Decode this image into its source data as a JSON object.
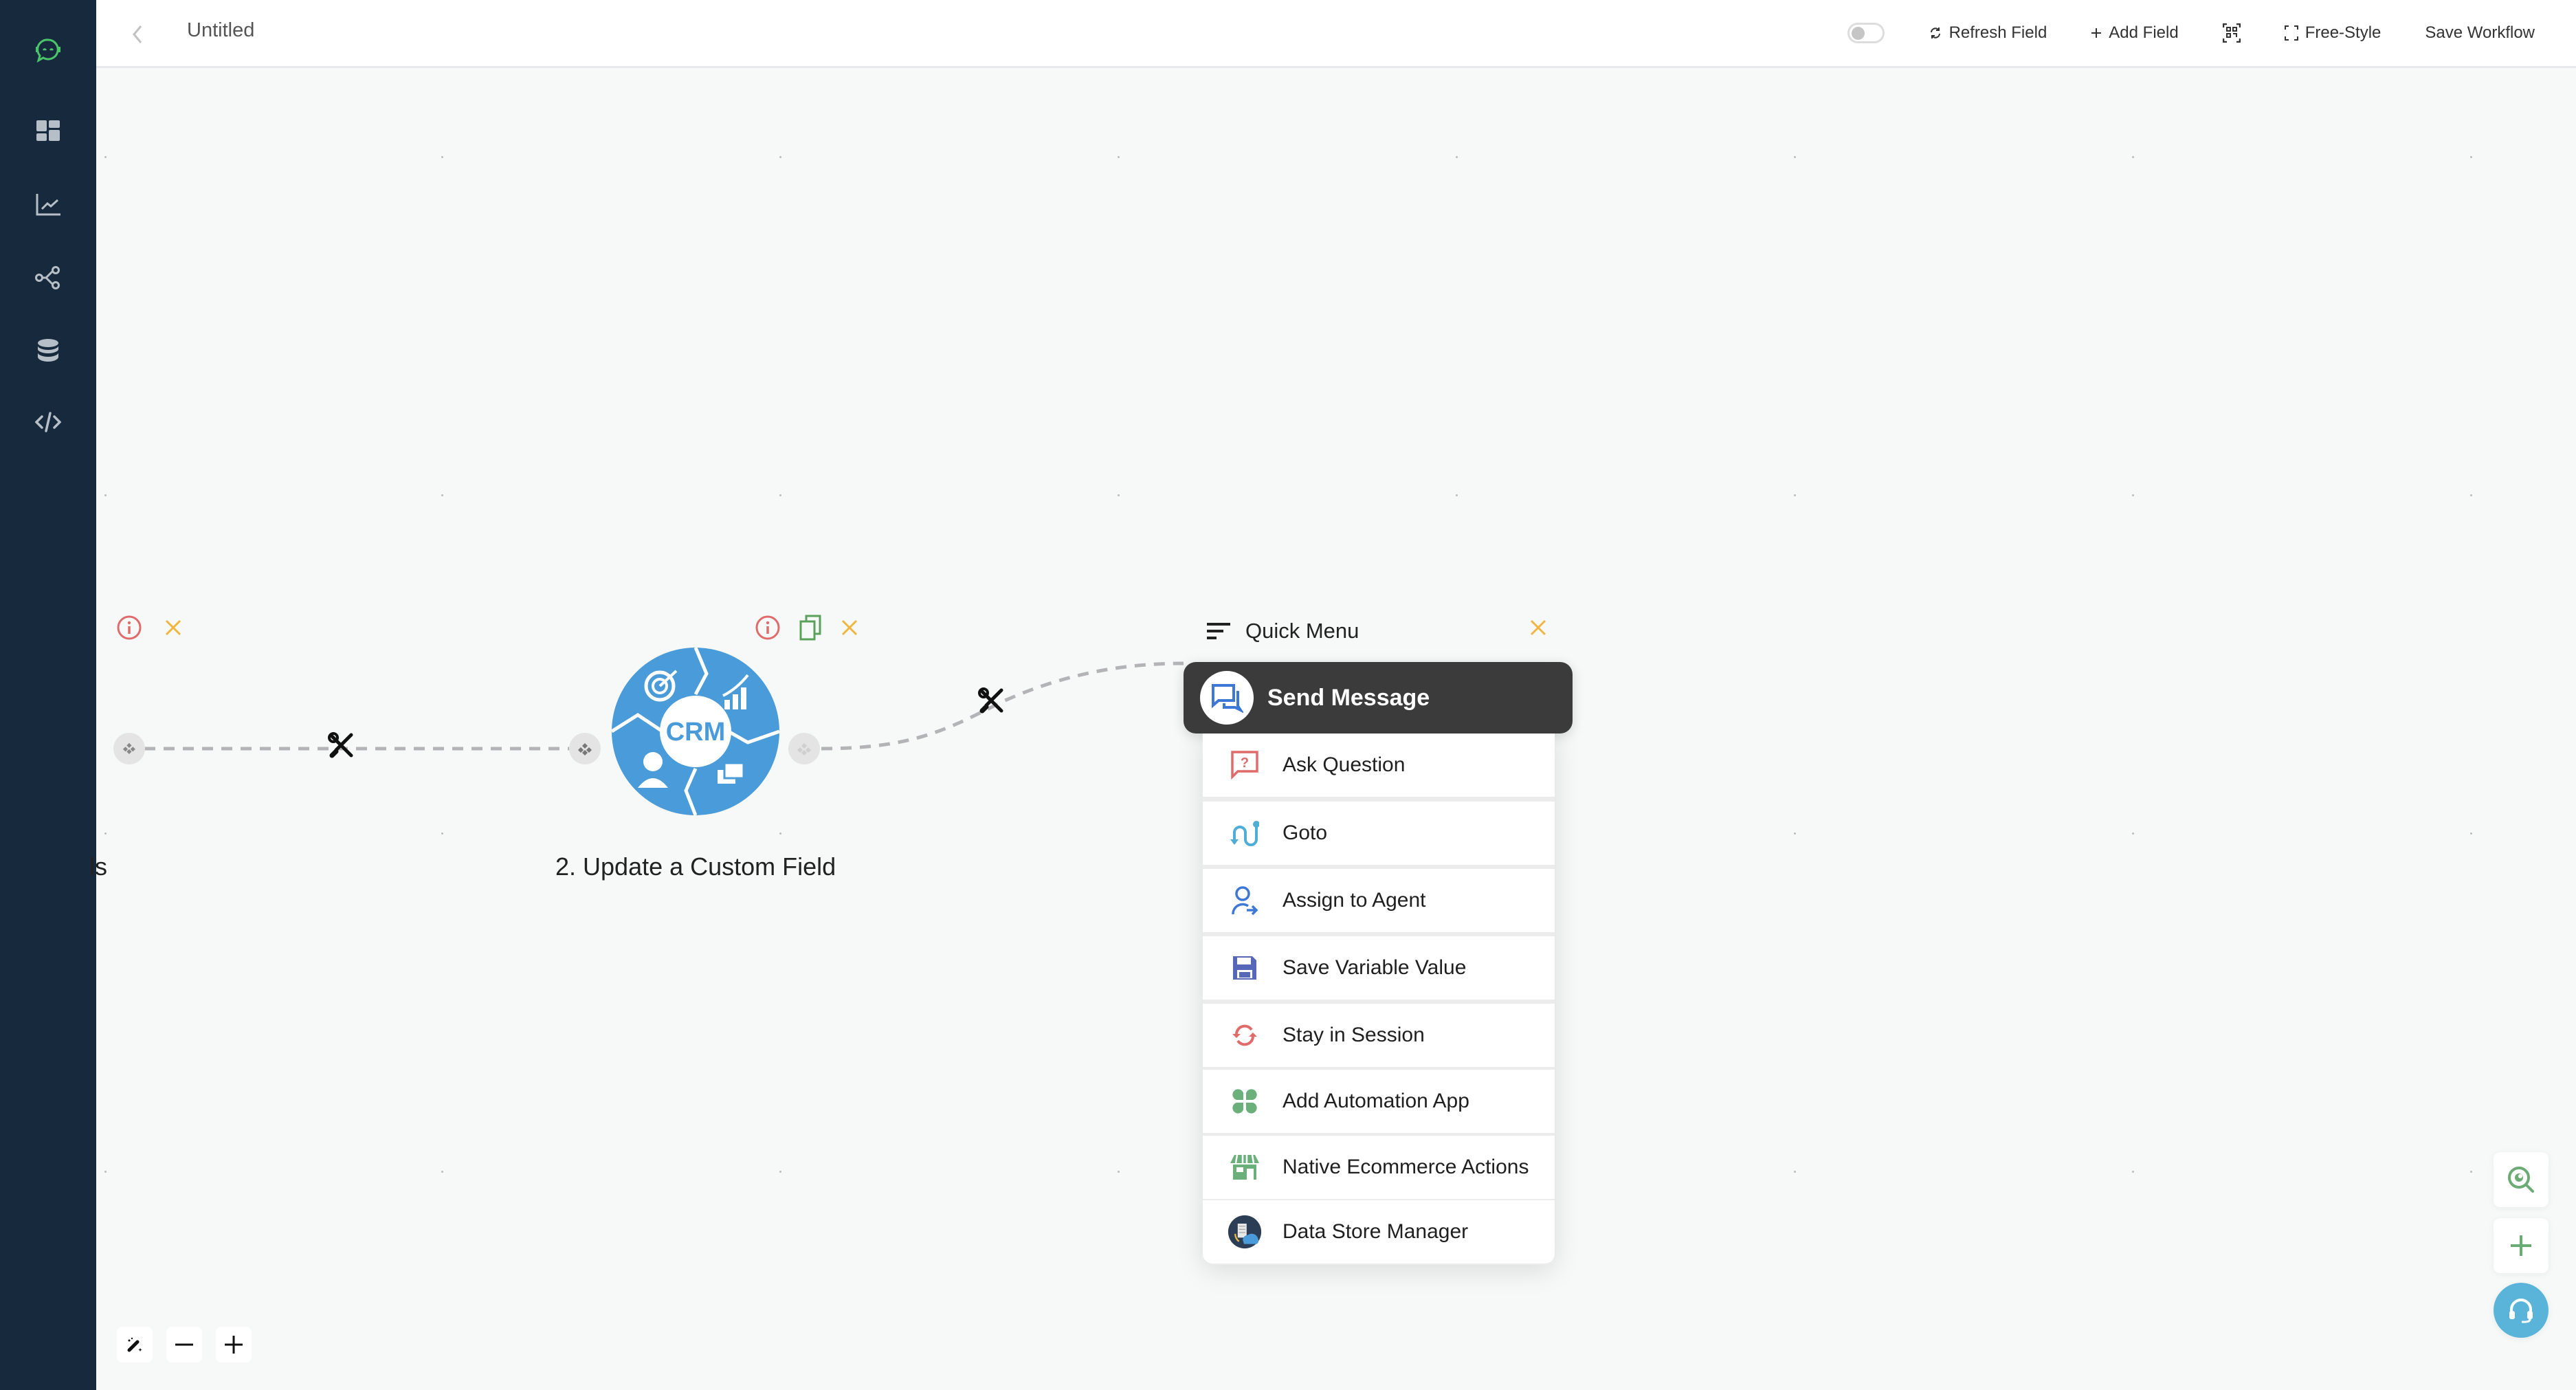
{
  "app": {
    "logo": "chatbot-logo-icon",
    "colors": {
      "sidebar_bg": "#17293d",
      "logo_green": "#4cc46a",
      "crm_blue": "#4a9bd9",
      "info_red": "#e06b6b",
      "close_orange": "#f0b63f",
      "copy_green": "#5aa25a",
      "menu_dark": "#3b3b3b",
      "support_blue": "#5ab4d9"
    }
  },
  "sidebar": {
    "items": [
      {
        "name": "dashboard",
        "icon": "grid-icon"
      },
      {
        "name": "analytics",
        "icon": "line-chart-icon"
      },
      {
        "name": "flows",
        "icon": "share-nodes-icon"
      },
      {
        "name": "database",
        "icon": "database-icon"
      },
      {
        "name": "code",
        "icon": "code-icon"
      }
    ]
  },
  "header": {
    "title": "Untitled",
    "toggle_state": "off",
    "refresh_label": "Refresh Field",
    "add_field_label": "Add Field",
    "free_style_label": "Free-Style",
    "save_label": "Save Workflow"
  },
  "canvas": {
    "nodes": [
      {
        "label_partial": "ls",
        "type": "unknown"
      },
      {
        "label": "2. Update a Custom Field",
        "image_text": "CRM"
      }
    ]
  },
  "quick_menu": {
    "title": "Quick Menu",
    "selected": "Send Message",
    "items": [
      {
        "label": "Ask Question",
        "icon": "question-bubble-icon"
      },
      {
        "label": "Goto",
        "icon": "goto-path-icon"
      },
      {
        "label": "Assign to Agent",
        "icon": "assign-agent-icon"
      },
      {
        "label": "Save Variable Value",
        "icon": "floppy-disk-icon"
      },
      {
        "label": "Stay in Session",
        "icon": "sync-icon"
      },
      {
        "label": "Add Automation App",
        "icon": "clover-apps-icon"
      },
      {
        "label": "Native Ecommerce Actions",
        "icon": "storefront-icon"
      },
      {
        "label": "Data Store Manager",
        "icon": "data-store-icon"
      }
    ]
  },
  "bottom_controls": {
    "magic": "magic-wand-icon",
    "zoom_out": "minus-icon",
    "zoom_in": "plus-icon"
  },
  "right_controls": {
    "find": "search-eye-icon",
    "add": "plus-icon",
    "support": "headset-icon"
  }
}
